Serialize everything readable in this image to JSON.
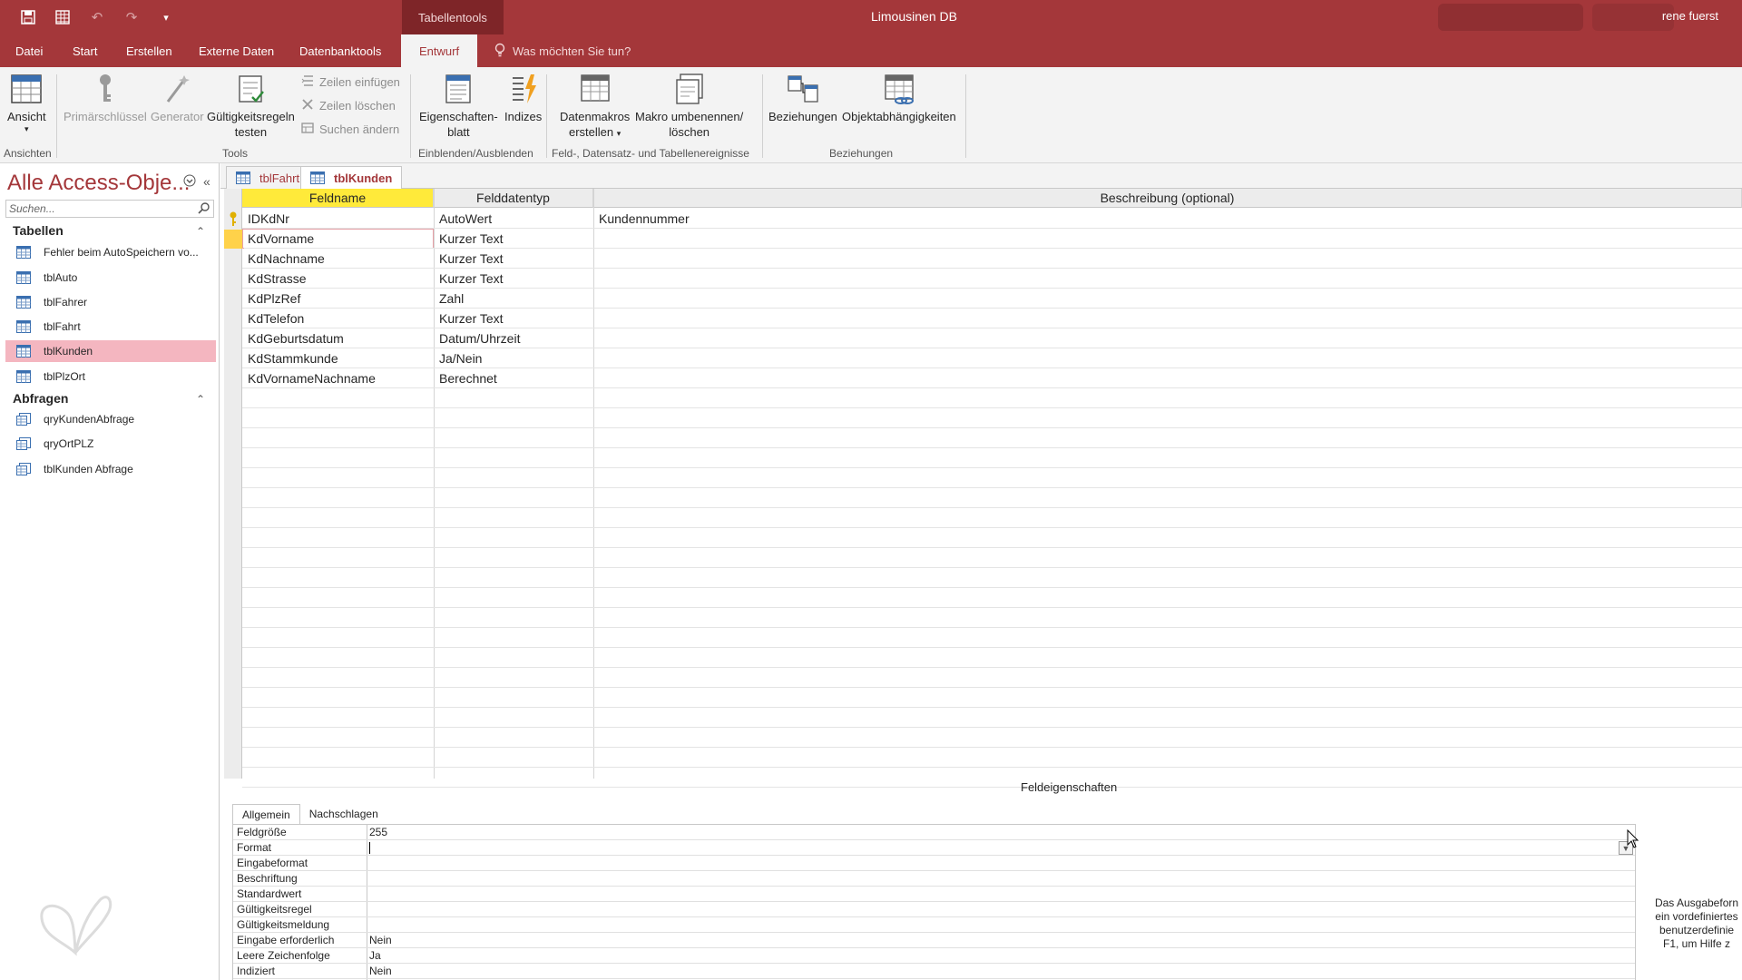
{
  "titlebar": {
    "contextual_tab": "Tabellentools",
    "app_title": "Limousinen DB",
    "user": "rene fuerst"
  },
  "ribbon_tabs": [
    "Datei",
    "Start",
    "Erstellen",
    "Externe Daten",
    "Datenbanktools",
    "Entwurf"
  ],
  "tell_me": "Was möchten Sie tun?",
  "ribbon": {
    "ansicht": "Ansicht",
    "primaerschluessel": "Primärschlüssel",
    "generator": "Generator",
    "gueltigkeitsregeln_1": "Gültigkeitsregeln",
    "gueltigkeitsregeln_2": "testen",
    "zeilen_einfuegen": "Zeilen einfügen",
    "zeilen_loeschen": "Zeilen löschen",
    "suchen_aendern": "Suchen ändern",
    "eigenschaftenblatt_1": "Eigenschaften-",
    "eigenschaftenblatt_2": "blatt",
    "indizes": "Indizes",
    "datenmakros_1": "Datenmakros",
    "datenmakros_2": "erstellen",
    "makro_1": "Makro umbenennen/",
    "makro_2": "löschen",
    "beziehungen": "Beziehungen",
    "objektabhaengigkeiten": "Objektabhängigkeiten",
    "groups": {
      "ansichten": "Ansichten",
      "tools": "Tools",
      "einblenden": "Einblenden/Ausblenden",
      "ereignisse": "Feld-, Datensatz- und Tabellenereignisse",
      "beziehungen": "Beziehungen"
    }
  },
  "nav": {
    "title": "Alle Access-Obje...",
    "search_placeholder": "Suchen...",
    "groups": [
      {
        "name": "Tabellen",
        "items": [
          "Fehler beim AutoSpeichern vo...",
          "tblAuto",
          "tblFahrer",
          "tblFahrt",
          "tblKunden",
          "tblPlzOrt"
        ]
      },
      {
        "name": "Abfragen",
        "items": [
          "qryKundenAbfrage",
          "qryOrtPLZ",
          "tblKunden Abfrage"
        ]
      }
    ],
    "selected": "tblKunden"
  },
  "doc_tabs": [
    "tblFahrt",
    "tblKunden"
  ],
  "active_doc_tab": "tblKunden",
  "design": {
    "headers": [
      "Feldname",
      "Felddatentyp",
      "Beschreibung (optional)"
    ],
    "rows": [
      {
        "name": "IDKdNr",
        "type": "AutoWert",
        "desc": "Kundennummer",
        "primary_key": true
      },
      {
        "name": "KdVorname",
        "type": "Kurzer Text",
        "desc": ""
      },
      {
        "name": "KdNachname",
        "type": "Kurzer Text",
        "desc": ""
      },
      {
        "name": "KdStrasse",
        "type": "Kurzer Text",
        "desc": ""
      },
      {
        "name": "KdPlzRef",
        "type": "Zahl",
        "desc": ""
      },
      {
        "name": "KdTelefon",
        "type": "Kurzer Text",
        "desc": ""
      },
      {
        "name": "KdGeburtsdatum",
        "type": "Datum/Uhrzeit",
        "desc": ""
      },
      {
        "name": "KdStammkunde",
        "type": "Ja/Nein",
        "desc": ""
      },
      {
        "name": "KdVornameNachname",
        "type": "Berechnet",
        "desc": ""
      }
    ],
    "current_row": 1
  },
  "field_props": {
    "title": "Feldeigenschaften",
    "tabs": [
      "Allgemein",
      "Nachschlagen"
    ],
    "active_tab": "Allgemein",
    "rows": [
      {
        "label": "Feldgröße",
        "value": "255"
      },
      {
        "label": "Format",
        "value": ""
      },
      {
        "label": "Eingabeformat",
        "value": ""
      },
      {
        "label": "Beschriftung",
        "value": ""
      },
      {
        "label": "Standardwert",
        "value": ""
      },
      {
        "label": "Gültigkeitsregel",
        "value": ""
      },
      {
        "label": "Gültigkeitsmeldung",
        "value": ""
      },
      {
        "label": "Eingabe erforderlich",
        "value": "Nein"
      },
      {
        "label": "Leere Zeichenfolge",
        "value": "Ja"
      },
      {
        "label": "Indiziert",
        "value": "Nein"
      }
    ],
    "help_lines": [
      "Das Ausgabeforn",
      "ein vordefiniertes",
      "benutzerdefinie",
      "F1, um Hilfe z"
    ]
  },
  "colors": {
    "accent": "#a4373a",
    "header_active": "#ffea3a",
    "nav_selected": "#f4b6c0"
  }
}
